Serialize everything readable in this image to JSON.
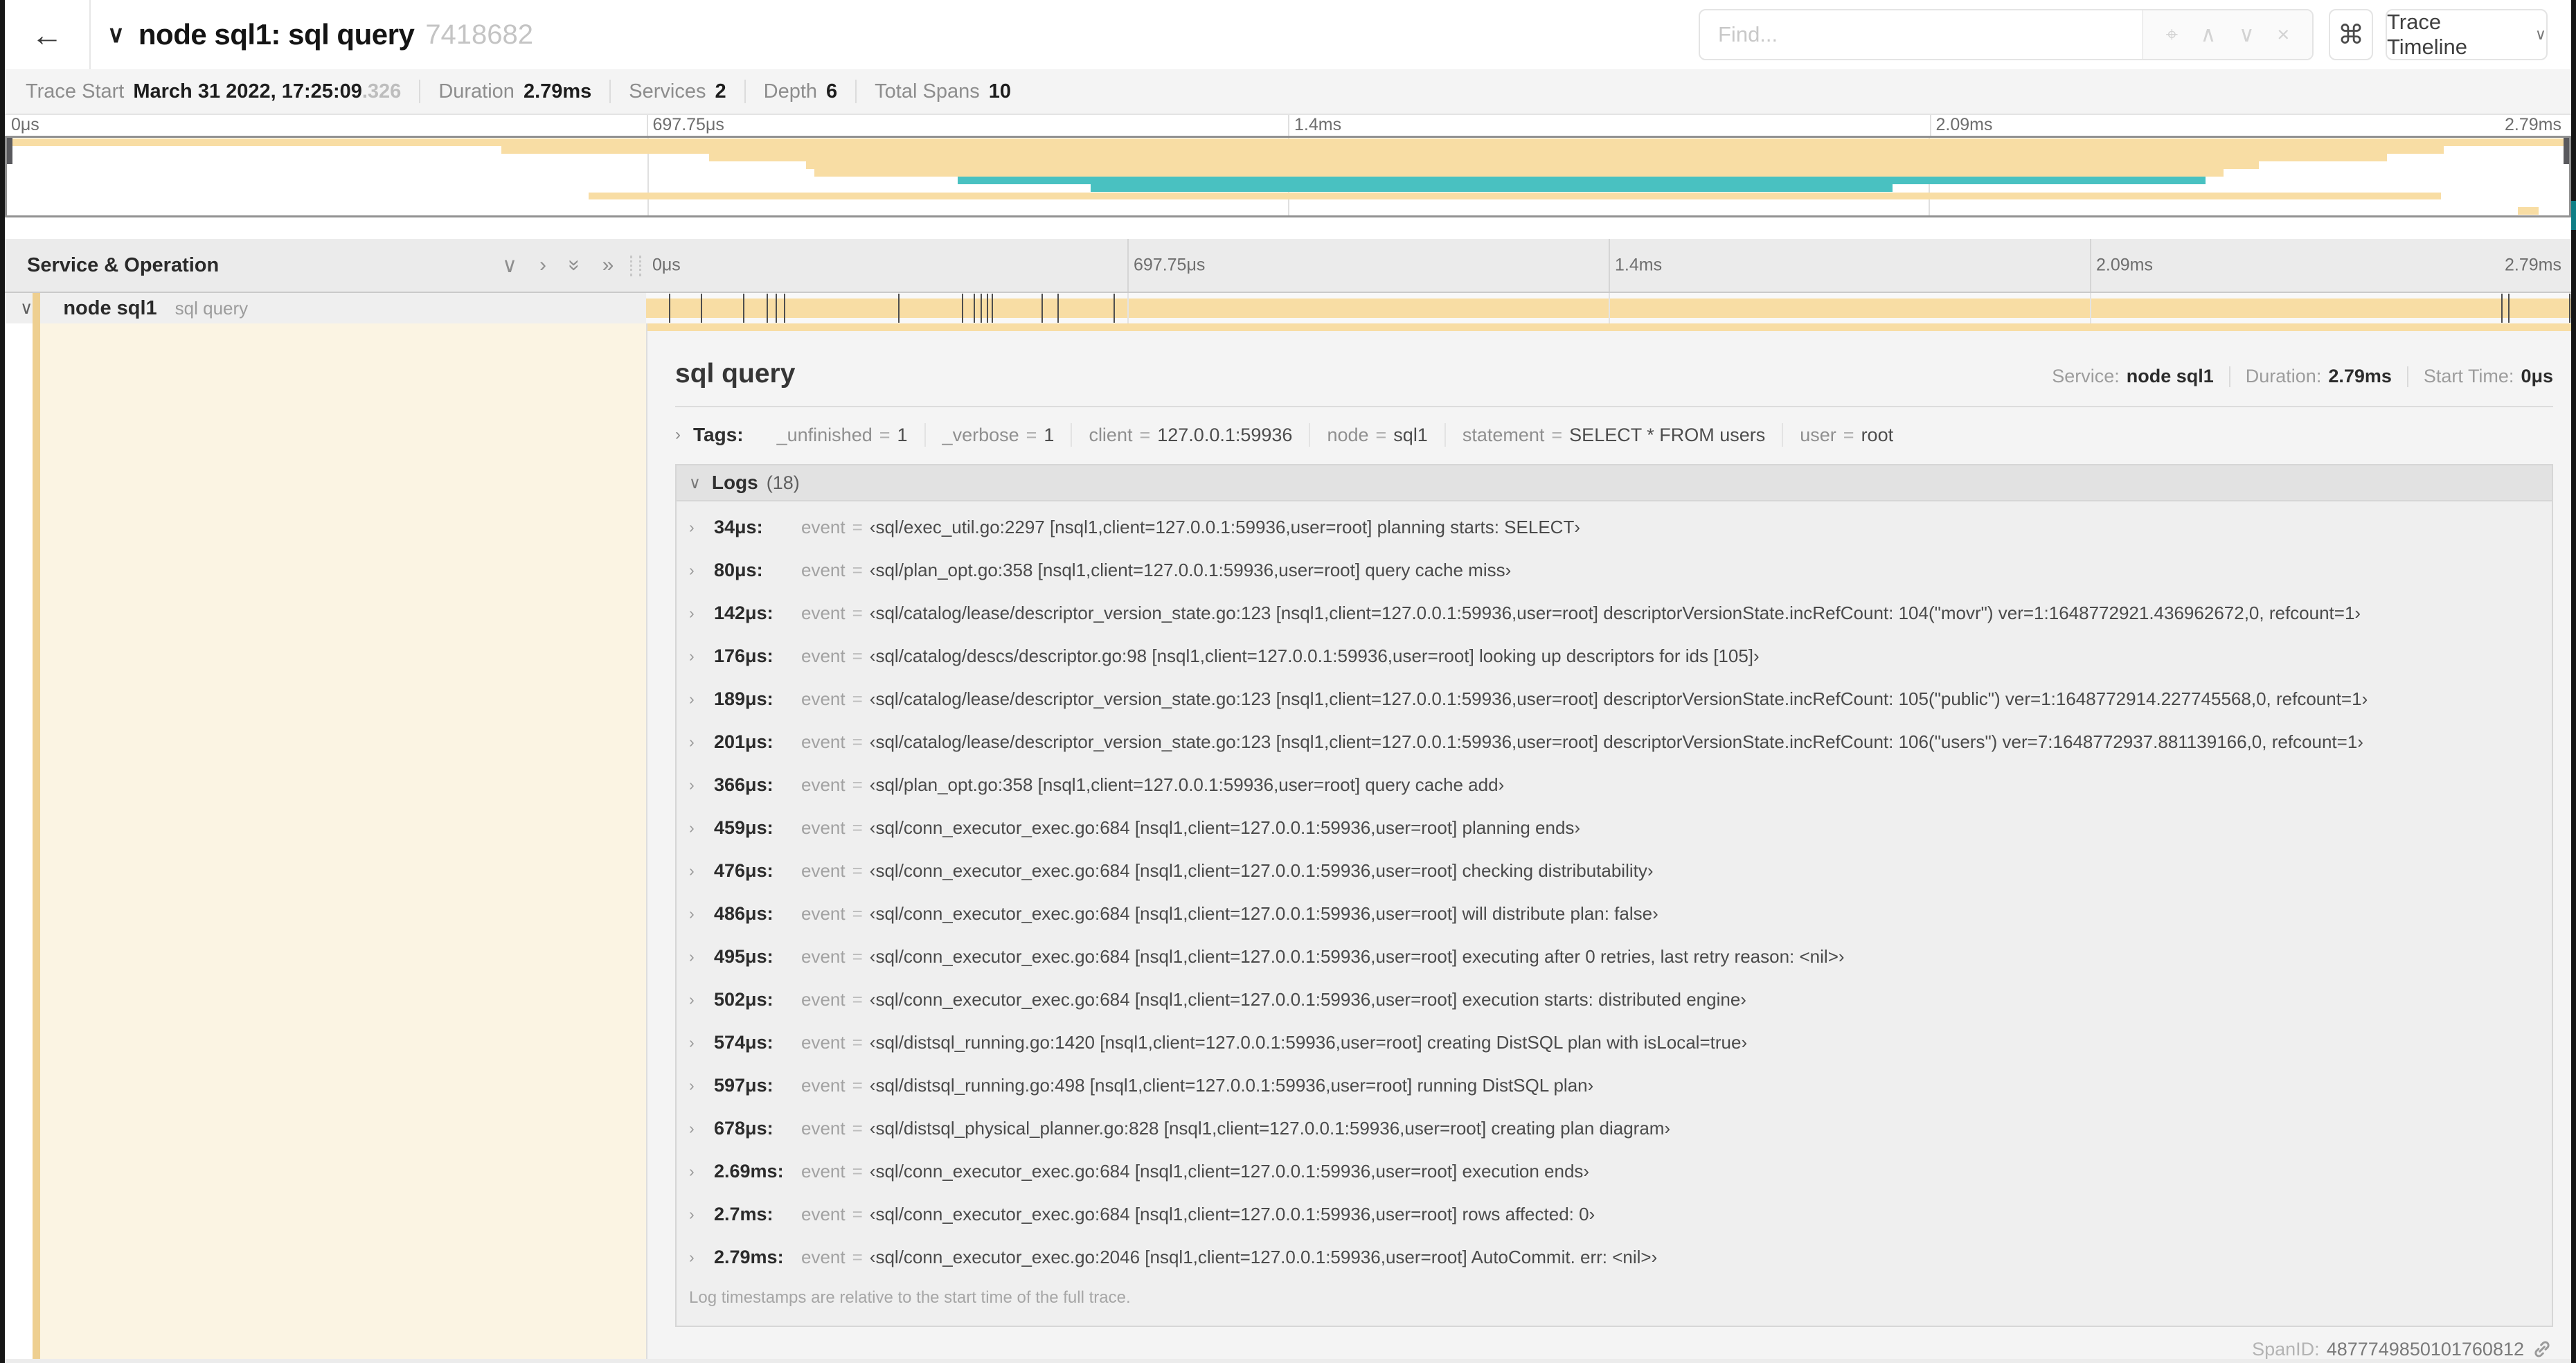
{
  "header": {
    "back_icon": "←",
    "collapse_icon": "∨",
    "title": "node sql1: sql query",
    "trace_id": "7418682",
    "find_placeholder": "Find...",
    "find_icons": [
      {
        "name": "locate-icon",
        "glyph": "⌖"
      },
      {
        "name": "prev-result-icon",
        "glyph": "∧"
      },
      {
        "name": "next-result-icon",
        "glyph": "∨"
      },
      {
        "name": "clear-search-icon",
        "glyph": "×"
      }
    ],
    "shortcut_icon": "⌘",
    "view_select_label": "Trace Timeline",
    "view_select_chevron": "∨"
  },
  "summary": {
    "items": [
      {
        "label": "Trace Start",
        "value": "March 31 2022, 17:25:09",
        "suffix": ".326"
      },
      {
        "label": "Duration",
        "value": "2.79ms"
      },
      {
        "label": "Services",
        "value": "2"
      },
      {
        "label": "Depth",
        "value": "6"
      },
      {
        "label": "Total Spans",
        "value": "10"
      }
    ]
  },
  "timeline": {
    "duration_us": 2790,
    "ruler_ticks": [
      "0μs",
      "697.75μs",
      "1.4ms",
      "2.09ms",
      "2.79ms"
    ],
    "colors": {
      "tan": "#F8DDA4",
      "tan_dark": "#EECF90",
      "teal": "#49C1C1",
      "cream": "#FBF4E3"
    },
    "minimap_rows": [
      {
        "lane": 0,
        "start": 0,
        "end": 100,
        "color": "tan"
      },
      {
        "lane": 1,
        "start": 19.3,
        "end": 95.1,
        "color": "tan"
      },
      {
        "lane": 2,
        "start": 27.4,
        "end": 92.9,
        "color": "tan"
      },
      {
        "lane": 3,
        "start": 31.2,
        "end": 87.9,
        "color": "tan"
      },
      {
        "lane": 4,
        "start": 31.5,
        "end": 86.5,
        "color": "tan"
      },
      {
        "lane": 5,
        "start": 37.1,
        "end": 85.8,
        "color": "teal"
      },
      {
        "lane": 6,
        "start": 42.3,
        "end": 73.6,
        "color": "teal"
      },
      {
        "lane": 7,
        "start": 22.7,
        "end": 95.0,
        "color": "tan"
      },
      {
        "lane": 8.9,
        "start": 98.0,
        "end": 98.8,
        "color": "tan"
      }
    ]
  },
  "span_table": {
    "header_label": "Service & Operation",
    "collapse_icons": [
      {
        "name": "collapse-one-icon",
        "glyph": "∨",
        "rot": 0
      },
      {
        "name": "expand-one-icon",
        "glyph": "›",
        "rot": 0
      },
      {
        "name": "collapse-all-icon",
        "glyph": "»",
        "rot": 90
      },
      {
        "name": "expand-all-icon",
        "glyph": "»",
        "rot": 0
      }
    ],
    "row": {
      "chevron": "∨",
      "service": "node sql1",
      "operation": "sql query"
    }
  },
  "detail": {
    "title": "sql query",
    "meta": [
      {
        "label": "Service:",
        "value": "node sql1"
      },
      {
        "label": "Duration:",
        "value": "2.79ms"
      },
      {
        "label": "Start Time:",
        "value": "0μs"
      }
    ],
    "chevron_right": "›",
    "chevron_down": "∨",
    "tags_label": "Tags:",
    "tags": [
      {
        "key": "_unfinished",
        "value": "1"
      },
      {
        "key": "_verbose",
        "value": "1"
      },
      {
        "key": "client",
        "value": "127.0.0.1:59936"
      },
      {
        "key": "node",
        "value": "sql1"
      },
      {
        "key": "statement",
        "value": "SELECT * FROM users"
      },
      {
        "key": "user",
        "value": "root"
      }
    ],
    "logs_label": "Logs",
    "logs_count": "(18)",
    "log_field_key": "event",
    "logs": [
      {
        "time": "34μs:",
        "time_us": 34,
        "value": "‹sql/exec_util.go:2297 [nsql1,client=127.0.0.1:59936,user=root] planning starts: SELECT›"
      },
      {
        "time": "80μs:",
        "time_us": 80,
        "value": "‹sql/plan_opt.go:358 [nsql1,client=127.0.0.1:59936,user=root] query cache miss›"
      },
      {
        "time": "142μs:",
        "time_us": 142,
        "value": "‹sql/catalog/lease/descriptor_version_state.go:123 [nsql1,client=127.0.0.1:59936,user=root] descriptorVersionState.incRefCount: 104(\"movr\") ver=1:1648772921.436962672,0, refcount=1›"
      },
      {
        "time": "176μs:",
        "time_us": 176,
        "value": "‹sql/catalog/descs/descriptor.go:98 [nsql1,client=127.0.0.1:59936,user=root] looking up descriptors for ids [105]›"
      },
      {
        "time": "189μs:",
        "time_us": 189,
        "value": "‹sql/catalog/lease/descriptor_version_state.go:123 [nsql1,client=127.0.0.1:59936,user=root] descriptorVersionState.incRefCount: 105(\"public\") ver=1:1648772914.227745568,0, refcount=1›"
      },
      {
        "time": "201μs:",
        "time_us": 201,
        "value": "‹sql/catalog/lease/descriptor_version_state.go:123 [nsql1,client=127.0.0.1:59936,user=root] descriptorVersionState.incRefCount: 106(\"users\") ver=7:1648772937.881139166,0, refcount=1›"
      },
      {
        "time": "366μs:",
        "time_us": 366,
        "value": "‹sql/plan_opt.go:358 [nsql1,client=127.0.0.1:59936,user=root] query cache add›"
      },
      {
        "time": "459μs:",
        "time_us": 459,
        "value": "‹sql/conn_executor_exec.go:684 [nsql1,client=127.0.0.1:59936,user=root] planning ends›"
      },
      {
        "time": "476μs:",
        "time_us": 476,
        "value": "‹sql/conn_executor_exec.go:684 [nsql1,client=127.0.0.1:59936,user=root] checking distributability›"
      },
      {
        "time": "486μs:",
        "time_us": 486,
        "value": "‹sql/conn_executor_exec.go:684 [nsql1,client=127.0.0.1:59936,user=root] will distribute plan: false›"
      },
      {
        "time": "495μs:",
        "time_us": 495,
        "value": "‹sql/conn_executor_exec.go:684 [nsql1,client=127.0.0.1:59936,user=root] executing after 0 retries, last retry reason: <nil>›"
      },
      {
        "time": "502μs:",
        "time_us": 502,
        "value": "‹sql/conn_executor_exec.go:684 [nsql1,client=127.0.0.1:59936,user=root] execution starts: distributed engine›"
      },
      {
        "time": "574μs:",
        "time_us": 574,
        "value": "‹sql/distsql_running.go:1420 [nsql1,client=127.0.0.1:59936,user=root] creating DistSQL plan with isLocal=true›"
      },
      {
        "time": "597μs:",
        "time_us": 597,
        "value": "‹sql/distsql_running.go:498 [nsql1,client=127.0.0.1:59936,user=root] running DistSQL plan›"
      },
      {
        "time": "678μs:",
        "time_us": 678,
        "value": "‹sql/distsql_physical_planner.go:828 [nsql1,client=127.0.0.1:59936,user=root] creating plan diagram›"
      },
      {
        "time": "2.69ms:",
        "time_us": 2690,
        "value": "‹sql/conn_executor_exec.go:684 [nsql1,client=127.0.0.1:59936,user=root] execution ends›"
      },
      {
        "time": "2.7ms:",
        "time_us": 2700,
        "value": "‹sql/conn_executor_exec.go:684 [nsql1,client=127.0.0.1:59936,user=root] rows affected: 0›"
      },
      {
        "time": "2.79ms:",
        "time_us": 2790,
        "value": "‹sql/conn_executor_exec.go:2046 [nsql1,client=127.0.0.1:59936,user=root] AutoCommit. err: <nil>›"
      }
    ],
    "logs_footnote": "Log timestamps are relative to the start time of the full trace.",
    "spanid_label": "SpanID:",
    "spanid_value": "4877749850101760812"
  }
}
